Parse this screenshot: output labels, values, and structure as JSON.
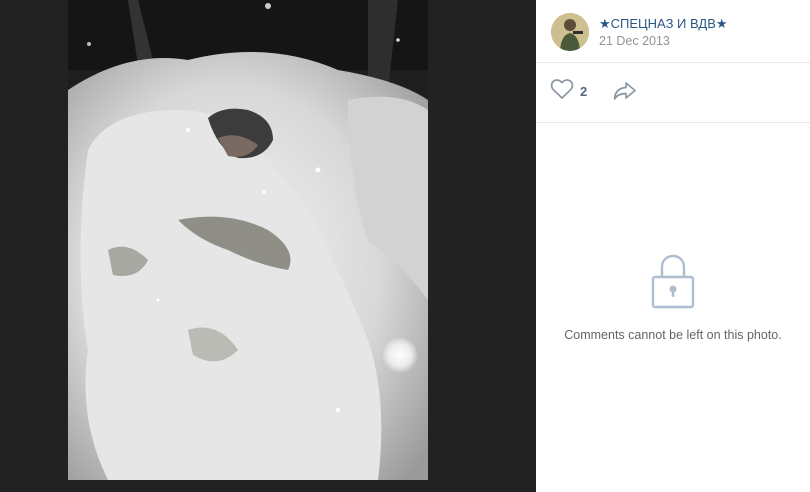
{
  "post": {
    "author": "★СПЕЦНАЗ И ВДВ★",
    "date": "21 Dec 2013",
    "likes": "2"
  },
  "comments": {
    "locked_message": "Comments cannot be left on this photo."
  },
  "icons": {
    "like": "heart-outline",
    "share": "arrow-forward",
    "lock": "padlock"
  },
  "colors": {
    "author_link": "#2a5885",
    "icon_gray": "#99a2ad",
    "lock_blue": "#aebed1",
    "viewer_bg": "#222222"
  }
}
